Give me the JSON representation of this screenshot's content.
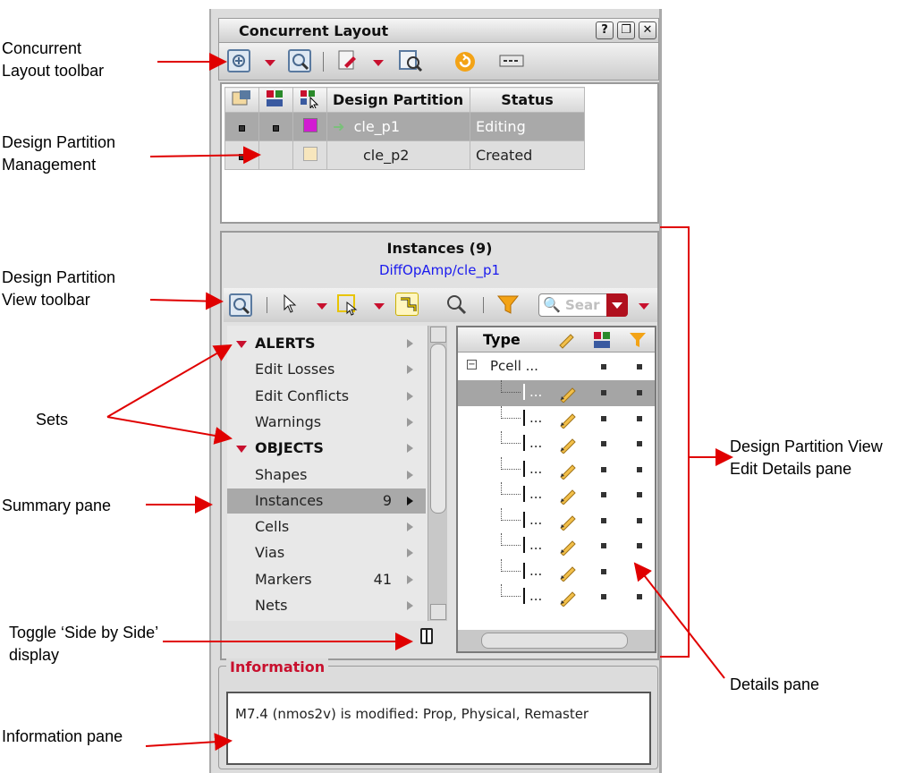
{
  "panel": {
    "title": "Concurrent Layout",
    "window_buttons": [
      "?",
      "❐",
      "✕"
    ]
  },
  "callouts": {
    "toolbar": "Concurrent\nLayout toolbar",
    "partition_mgmt": "Design Partition\nManagement",
    "view_toolbar": "Design Partition\nView toolbar",
    "sets": "Sets",
    "summary": "Summary pane",
    "toggle": "Toggle ‘Side by Side’\ndisplay",
    "information": "Information pane",
    "edit_details": "Design Partition View\nEdit Details pane",
    "details": "Details pane"
  },
  "partitions": {
    "columns": [
      "Design Partition",
      "Status"
    ],
    "rows": [
      {
        "name": "cle_p1",
        "status": "Editing",
        "color": "#d21bd2"
      },
      {
        "name": "cle_p2",
        "status": "Created",
        "color": "#f7e6bd"
      }
    ]
  },
  "view": {
    "heading": "Instances (9)",
    "path": "DiffOpAmp/cle_p1",
    "search_placeholder": "Sear"
  },
  "sets": [
    {
      "label": "ALERTS",
      "header": true
    },
    {
      "label": "Edit Losses"
    },
    {
      "label": "Edit Conflicts"
    },
    {
      "label": "Warnings"
    },
    {
      "label": "OBJECTS",
      "header": true
    },
    {
      "label": "Shapes"
    },
    {
      "label": "Instances",
      "count": "9",
      "selected": true
    },
    {
      "label": "Cells"
    },
    {
      "label": "Vias"
    },
    {
      "label": "Markers",
      "count": "41"
    },
    {
      "label": "Nets"
    }
  ],
  "details": {
    "column": "Type",
    "root": "Pcell ...",
    "child": "...",
    "child_count": 9
  },
  "information": {
    "legend": "Information",
    "message": "M7.4 (nmos2v) is modified: Prop, Physical, Remaster"
  }
}
